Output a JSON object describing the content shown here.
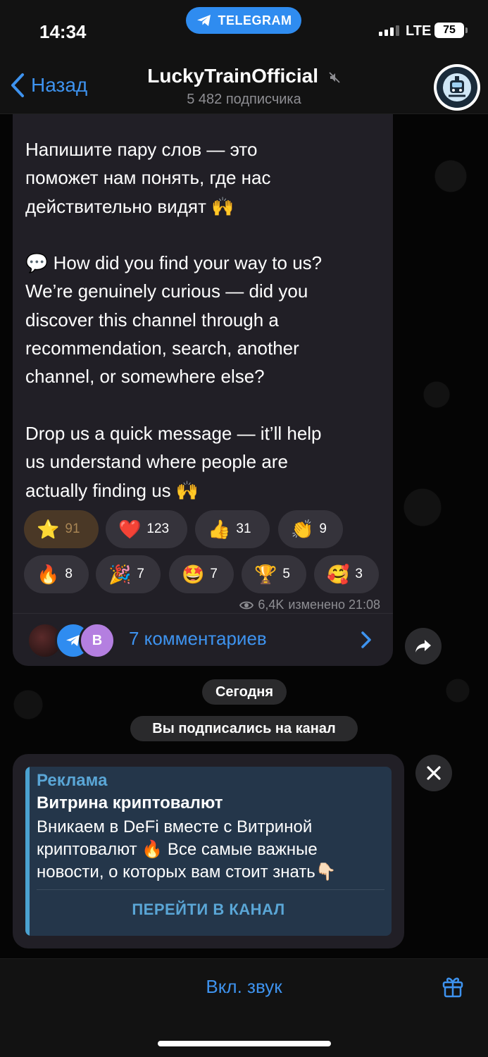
{
  "status_bar": {
    "time": "14:34",
    "app_pill": "TELEGRAM",
    "network": "LTE",
    "battery": "75"
  },
  "nav": {
    "back_label": "Назад",
    "title": "LuckyTrainOfficial",
    "subtitle": "5 482 подписчика"
  },
  "post": {
    "paragraphs": [
      [
        "Напишите пару слов — это",
        "поможет нам понять, где нас",
        "действительно видят 🙌"
      ],
      [
        "💬 How did you find your way to us?",
        "We’re genuinely curious — did you",
        "discover this channel through a",
        "recommendation, search, another",
        "channel, or somewhere else?"
      ],
      [
        "Drop us a quick message — it’ll help",
        "us understand where people are",
        "actually finding us 🙌"
      ]
    ],
    "reactions": [
      {
        "emoji": "⭐",
        "count": "91",
        "active": true
      },
      {
        "emoji": "❤️",
        "count": "123"
      },
      {
        "emoji": "👍",
        "count": "31"
      },
      {
        "emoji": "👏",
        "count": "9"
      },
      {
        "emoji": "🔥",
        "count": "8"
      },
      {
        "emoji": "🎉",
        "count": "7"
      },
      {
        "emoji": "🤩",
        "count": "7"
      },
      {
        "emoji": "🏆",
        "count": "5"
      },
      {
        "emoji": "🥰",
        "count": "3"
      }
    ],
    "views": "6,4K",
    "edited_time": "изменено 21:08",
    "comments_label": "7 комментариев",
    "comment_avatar_letter": "B"
  },
  "service": {
    "date": "Сегодня",
    "subscribed": "Вы подписались на канал"
  },
  "ad": {
    "label": "Реклама",
    "title": "Витрина криптовалют",
    "text_lines": [
      "Вникаем в DeFi вместе с Витриной",
      "криптовалют 🔥 Все самые важные",
      "новости, о которых вам стоит знать👇🏻"
    ],
    "cta": "ПЕРЕЙТИ В КАНАЛ"
  },
  "bottom": {
    "sound_label": "Вкл. звук"
  },
  "colors": {
    "accent": "#3e93ef",
    "bubble": "#211f26",
    "ad_card": "#24364a",
    "star_reaction": "#4a3826"
  },
  "icons": [
    "telegram-icon",
    "back-chevron-icon",
    "mute-icon",
    "eye-icon",
    "chevron-right-icon",
    "share-icon",
    "close-icon",
    "gift-icon"
  ]
}
